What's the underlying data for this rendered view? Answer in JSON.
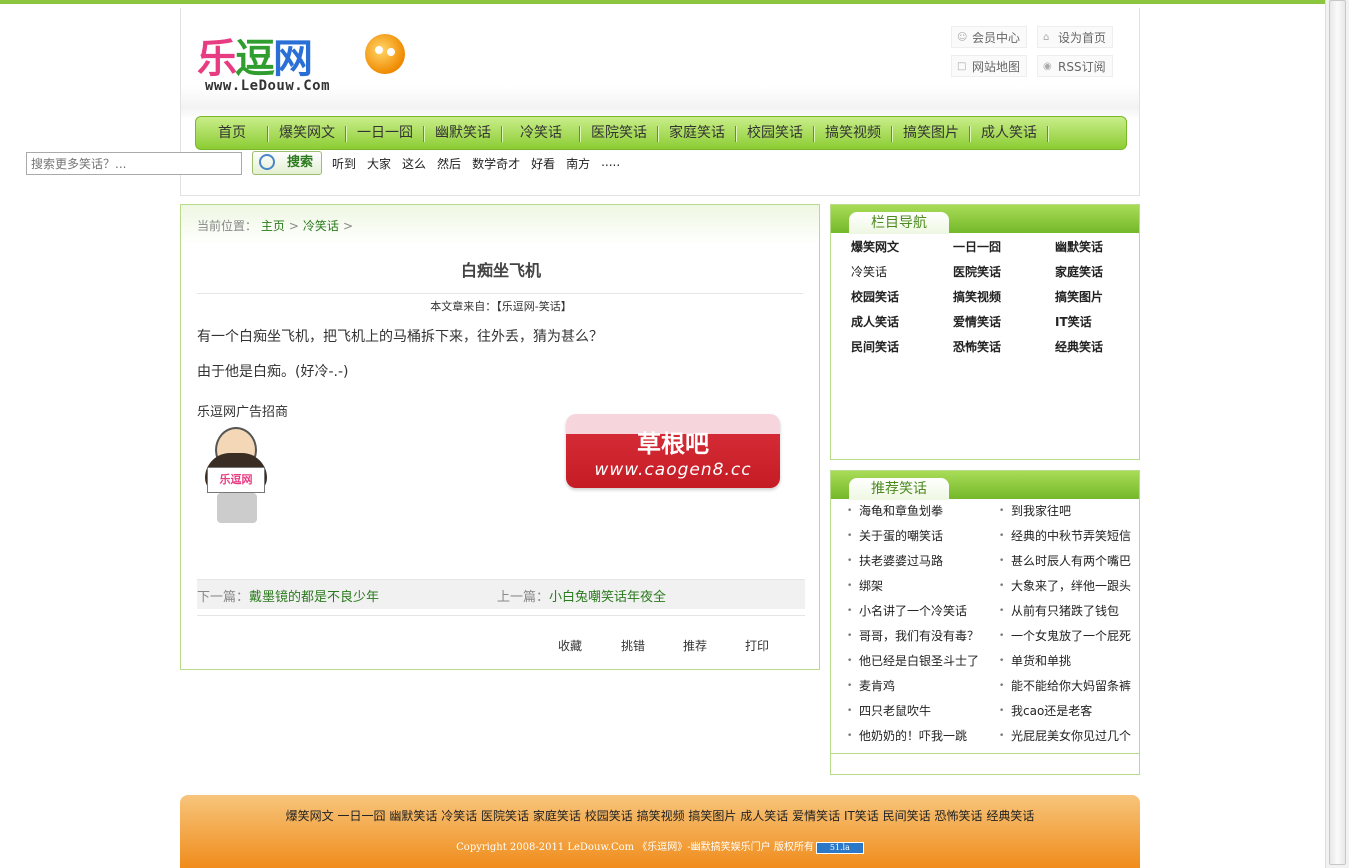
{
  "site": {
    "logo_text": [
      "乐",
      "逗",
      "网"
    ],
    "logo_url": "www.LeDouw.Com"
  },
  "toplinks": [
    "会员中心",
    "设为首页",
    "网站地图",
    "RSS订阅"
  ],
  "nav": [
    "首页",
    "爆笑网文",
    "一日一囧",
    "幽默笑话",
    "冷笑话",
    "医院笑话",
    "家庭笑话",
    "校园笑话",
    "搞笑视频",
    "搞笑图片",
    "成人笑话"
  ],
  "search": {
    "placeholder": "搜索更多笑话？...",
    "button": "搜索",
    "hotwords": [
      "听到",
      "大家",
      "这么",
      "然后",
      "数学奇才",
      "好看",
      "南方",
      "....."
    ]
  },
  "breadcrumb": {
    "prefix": "当前位置：",
    "home": "主页",
    "category": "冷笑话",
    "sep": ">"
  },
  "article": {
    "title": "白痴坐飞机",
    "source_label": "本文章来自：",
    "source": "【乐逗网-笑话】",
    "p1": "有一个白痴坐飞机，把飞机上的马桶拆下来，往外丢，猜为甚么？",
    "p2": "由于他是白痴。(好冷-.-)",
    "ad_label": "乐逗网广告招商",
    "ad_sign": "乐逗网"
  },
  "watermark": {
    "cn": "草根吧",
    "url": "www.caogen8.cc"
  },
  "prevnext": {
    "next_label": "下一篇：",
    "next_title": "戴墨镜的都是不良少年",
    "prev_label": "上一篇：",
    "prev_title": "小白兔嘲笑话年夜全"
  },
  "tools": [
    "收藏",
    "挑错",
    "推荐",
    "打印"
  ],
  "sidebar_nav": {
    "title": "栏目导航",
    "items": [
      "爆笑网文",
      "一日一囧",
      "幽默笑话",
      "冷笑话",
      "医院笑话",
      "家庭笑话",
      "校园笑话",
      "搞笑视频",
      "搞笑图片",
      "成人笑话",
      "爱情笑话",
      "IT笑话",
      "民间笑话",
      "恐怖笑话",
      "经典笑话"
    ]
  },
  "recommend": {
    "title": "推荐笑话",
    "items": [
      "海龟和章鱼划拳",
      "到我家往吧",
      "关于蛋的嘲笑话",
      "经典的中秋节弄笑短信",
      "扶老婆婆过马路",
      "甚么时辰人有两个嘴巴",
      "绑架",
      "大象来了，绊他一跟头",
      "小名讲了一个冷笑话",
      "从前有只猪跌了钱包",
      "哥哥，我们有没有毒？",
      "一个女鬼放了一个屁死",
      "他已经是白银圣斗士了",
      "单货和单挑",
      "麦肯鸡",
      "能不能给你大妈留条裤",
      "四只老鼠吹牛",
      "我cao还是老客",
      "他奶奶的！吓我一跳",
      "光屁屁美女你见过几个"
    ]
  },
  "footer": {
    "links": [
      "爆笑网文",
      "一日一囧",
      "幽默笑话",
      "冷笑话",
      "医院笑话",
      "家庭笑话",
      "校园笑话",
      "搞笑视频",
      "搞笑图片",
      "成人笑话",
      "爱情笑话",
      "IT笑话",
      "民间笑话",
      "恐怖笑话",
      "经典笑话"
    ],
    "copyright": "Copyright 2008-2011 LeDouw.Com 《乐逗网》-幽默搞笑娱乐门户 版权所有",
    "counter": "51.la"
  },
  "colors": {
    "accent_green": "#8cc63f",
    "link_green": "#2b7a1e",
    "footer_orange": "#f08c1c",
    "badge_red": "#c41b24"
  }
}
